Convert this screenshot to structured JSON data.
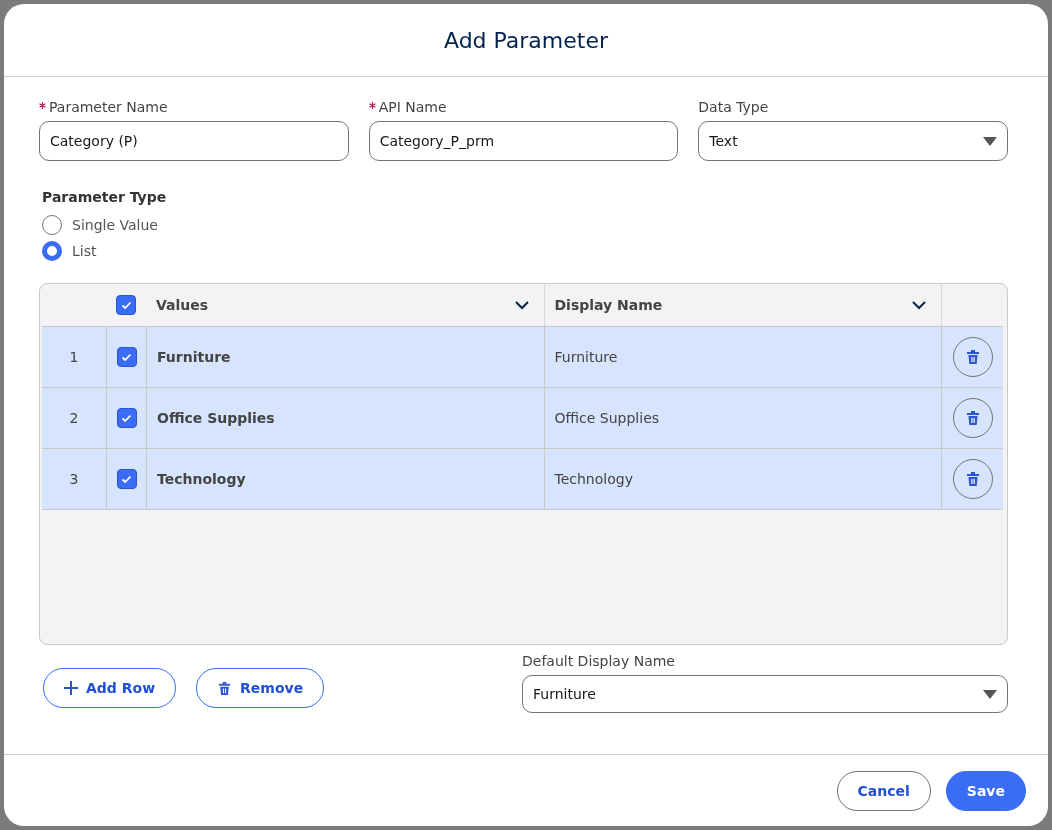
{
  "dialog": {
    "title": "Add Parameter"
  },
  "fields": [
    {
      "label": "Parameter Name",
      "required": true,
      "kind": "text",
      "value": "Category (P)"
    },
    {
      "label": "API Name",
      "required": true,
      "kind": "text",
      "value": "Category_P_prm"
    },
    {
      "label": "Data Type",
      "required": false,
      "kind": "select",
      "value": "Text"
    }
  ],
  "parameter_type": {
    "label": "Parameter Type",
    "options": [
      {
        "label": "Single Value",
        "selected": false
      },
      {
        "label": "List",
        "selected": true
      }
    ]
  },
  "table": {
    "all_checked": true,
    "columns": [
      "Values",
      "Display Name"
    ],
    "rows": [
      {
        "number": "1",
        "checked": true,
        "value": "Furniture",
        "display_name": "Furniture"
      },
      {
        "number": "2",
        "checked": true,
        "value": "Office Supplies",
        "display_name": "Office Supplies"
      },
      {
        "number": "3",
        "checked": true,
        "value": "Technology",
        "display_name": "Technology"
      }
    ]
  },
  "row_buttons": [
    {
      "label": "Add Row",
      "kind": "add"
    },
    {
      "label": "Remove",
      "kind": "remove"
    }
  ],
  "default_display": {
    "label": "Default Display Name",
    "value": "Furniture"
  },
  "footer_buttons": [
    {
      "label": "Cancel",
      "kind": "secondary"
    },
    {
      "label": "Save",
      "kind": "primary"
    }
  ]
}
